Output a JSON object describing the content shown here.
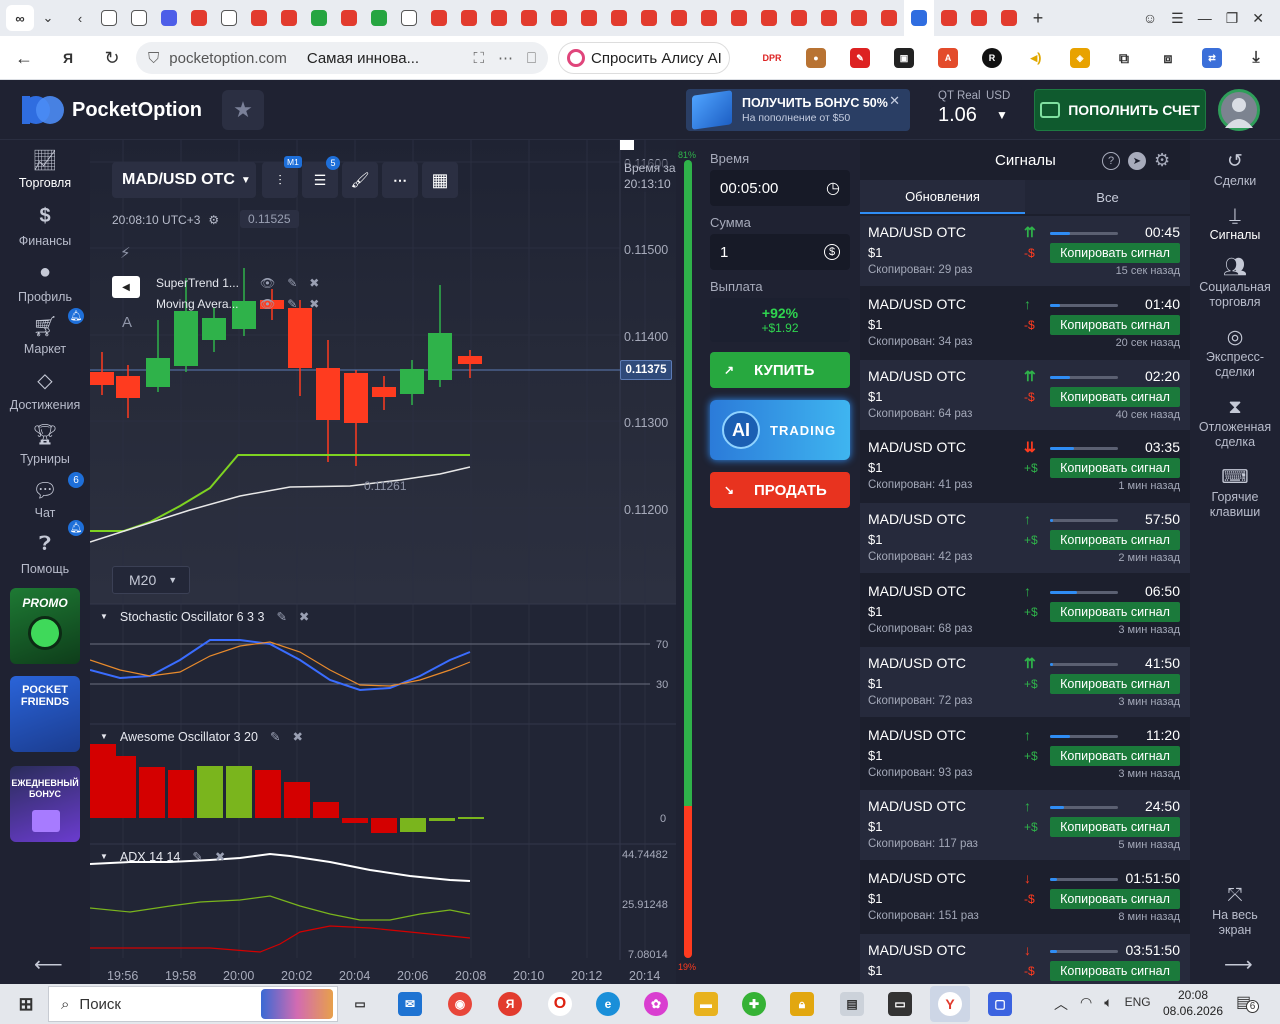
{
  "browser": {
    "url": "pocketoption.com",
    "page_title": "Самая иннова...",
    "alisa_label": "Спросить Алису AI"
  },
  "header": {
    "logo_text": "PocketOption",
    "bonus_title": "ПОЛУЧИТЬ БОНУС 50%",
    "bonus_sub": "На пополнение от $50",
    "account_type": "QT Real",
    "currency": "USD",
    "balance": "1.06",
    "deposit_label": "ПОПОЛНИТЬ СЧЕТ"
  },
  "left_nav": {
    "items": [
      {
        "label": "Торговля"
      },
      {
        "label": "Финансы"
      },
      {
        "label": "Профиль"
      },
      {
        "label": "Маркет"
      },
      {
        "label": "Достижения"
      },
      {
        "label": "Турниры"
      },
      {
        "label": "Чат",
        "badge": "6"
      },
      {
        "label": "Помощь"
      }
    ],
    "promo1": "PROMO",
    "promo2": "POCKET FRIENDS",
    "promo3": "ЕЖЕДНЕВНЫЙ БОНУС"
  },
  "chart": {
    "pair": "MAD/USD OTC",
    "timeframe_badge": "M1",
    "indicators_badge": "5",
    "clock": "20:08:10 UTC+3",
    "price_hover": "0.11525",
    "expiry_label": "Время за",
    "expiry_time": "20:13:10",
    "current_price": "0.11375",
    "low_label": "0.11261",
    "timeframe_select": "M20",
    "indicator1": "SuperTrend 1...",
    "indicator2": "Moving Avera...",
    "price_axis": [
      "0.11600",
      "0.11500",
      "0.11400",
      "0.11300",
      "0.11200"
    ],
    "time_axis": [
      "19:56",
      "19:58",
      "20:00",
      "20:02",
      "20:04",
      "20:06",
      "20:08",
      "20:10",
      "20:12",
      "20:14"
    ],
    "stoch_title": "Stochastic Oscillator  6 3 3",
    "stoch_levels": [
      "70",
      "30"
    ],
    "ao_title": "Awesome Oscillator  3 20",
    "ao_zero": "0",
    "adx_title": "ADX  14 14",
    "adx_levels": [
      "44.74482",
      "25.91248",
      "7.08014"
    ],
    "sentiment_top": "81%",
    "sentiment_bottom": "19%"
  },
  "trade": {
    "time_label": "Время",
    "time_value": "00:05:00",
    "amount_label": "Сумма",
    "amount_value": "1",
    "payout_label": "Выплата",
    "payout_pct": "+92%",
    "payout_amt": "+$1.92",
    "buy": "КУПИТЬ",
    "ai_short": "AI",
    "ai_long": "TRADING",
    "sell": "ПРОДАТЬ"
  },
  "signals": {
    "title": "Сигналы",
    "tab_updates": "Обновления",
    "tab_all": "Все",
    "copy_label": "Копировать сигнал",
    "rows": [
      {
        "pair": "MAD/USD OTC",
        "amount": "$1",
        "copied": "Скопирован: 29 раз",
        "arrow": "⇈",
        "dir": "-$",
        "up": true,
        "time": "00:45",
        "ago": "15 сек назад",
        "progress": 0.3
      },
      {
        "pair": "MAD/USD OTC",
        "amount": "$1",
        "copied": "Скопирован: 34 раз",
        "arrow": "↑",
        "dir": "-$",
        "up": true,
        "time": "01:40",
        "ago": "20 сек назад",
        "progress": 0.15
      },
      {
        "pair": "MAD/USD OTC",
        "amount": "$1",
        "copied": "Скопирован: 64 раз",
        "arrow": "⇈",
        "dir": "-$",
        "up": true,
        "time": "02:20",
        "ago": "40 сек назад",
        "progress": 0.3
      },
      {
        "pair": "MAD/USD OTC",
        "amount": "$1",
        "copied": "Скопирован: 41 раз",
        "arrow": "⇊",
        "dir": "+$",
        "up": false,
        "time": "03:35",
        "ago": "1 мин назад",
        "progress": 0.35
      },
      {
        "pair": "MAD/USD OTC",
        "amount": "$1",
        "copied": "Скопирован: 42 раз",
        "arrow": "↑",
        "dir": "+$",
        "up": true,
        "time": "57:50",
        "ago": "2 мин назад",
        "progress": 0.05
      },
      {
        "pair": "MAD/USD OTC",
        "amount": "$1",
        "copied": "Скопирован: 68 раз",
        "arrow": "↑",
        "dir": "+$",
        "up": true,
        "time": "06:50",
        "ago": "3 мин назад",
        "progress": 0.4
      },
      {
        "pair": "MAD/USD OTC",
        "amount": "$1",
        "copied": "Скопирован: 72 раз",
        "arrow": "⇈",
        "dir": "+$",
        "up": true,
        "time": "41:50",
        "ago": "3 мин назад",
        "progress": 0.05
      },
      {
        "pair": "MAD/USD OTC",
        "amount": "$1",
        "copied": "Скопирован: 93 раз",
        "arrow": "↑",
        "dir": "+$",
        "up": true,
        "time": "11:20",
        "ago": "3 мин назад",
        "progress": 0.3
      },
      {
        "pair": "MAD/USD OTC",
        "amount": "$1",
        "copied": "Скопирован: 117 раз",
        "arrow": "↑",
        "dir": "+$",
        "up": true,
        "time": "24:50",
        "ago": "5 мин назад",
        "progress": 0.2
      },
      {
        "pair": "MAD/USD OTC",
        "amount": "$1",
        "copied": "Скопирован: 151 раз",
        "arrow": "↓",
        "dir": "-$",
        "up": false,
        "time": "01:51:50",
        "ago": "8 мин назад",
        "progress": 0.1
      },
      {
        "pair": "MAD/USD OTC",
        "amount": "$1",
        "copied": "",
        "arrow": "↓",
        "dir": "-$",
        "up": false,
        "time": "03:51:50",
        "ago": "",
        "progress": 0.1
      }
    ]
  },
  "right_nav": {
    "items": [
      "Сделки",
      "Сигналы",
      "Социальная торговля",
      "Экспресс-сделки",
      "Отложенная сделка",
      "Горячие клавиши"
    ],
    "fullscreen": "На весь экран"
  },
  "taskbar": {
    "search": "Поиск",
    "lang": "ENG",
    "time": "20:08",
    "date": "08.06.2026",
    "notif": "6"
  },
  "colors": {
    "green": "#2fb24a",
    "red": "#ff3b1f",
    "blue": "#2f8df5",
    "bg": "#1c1f2d"
  }
}
